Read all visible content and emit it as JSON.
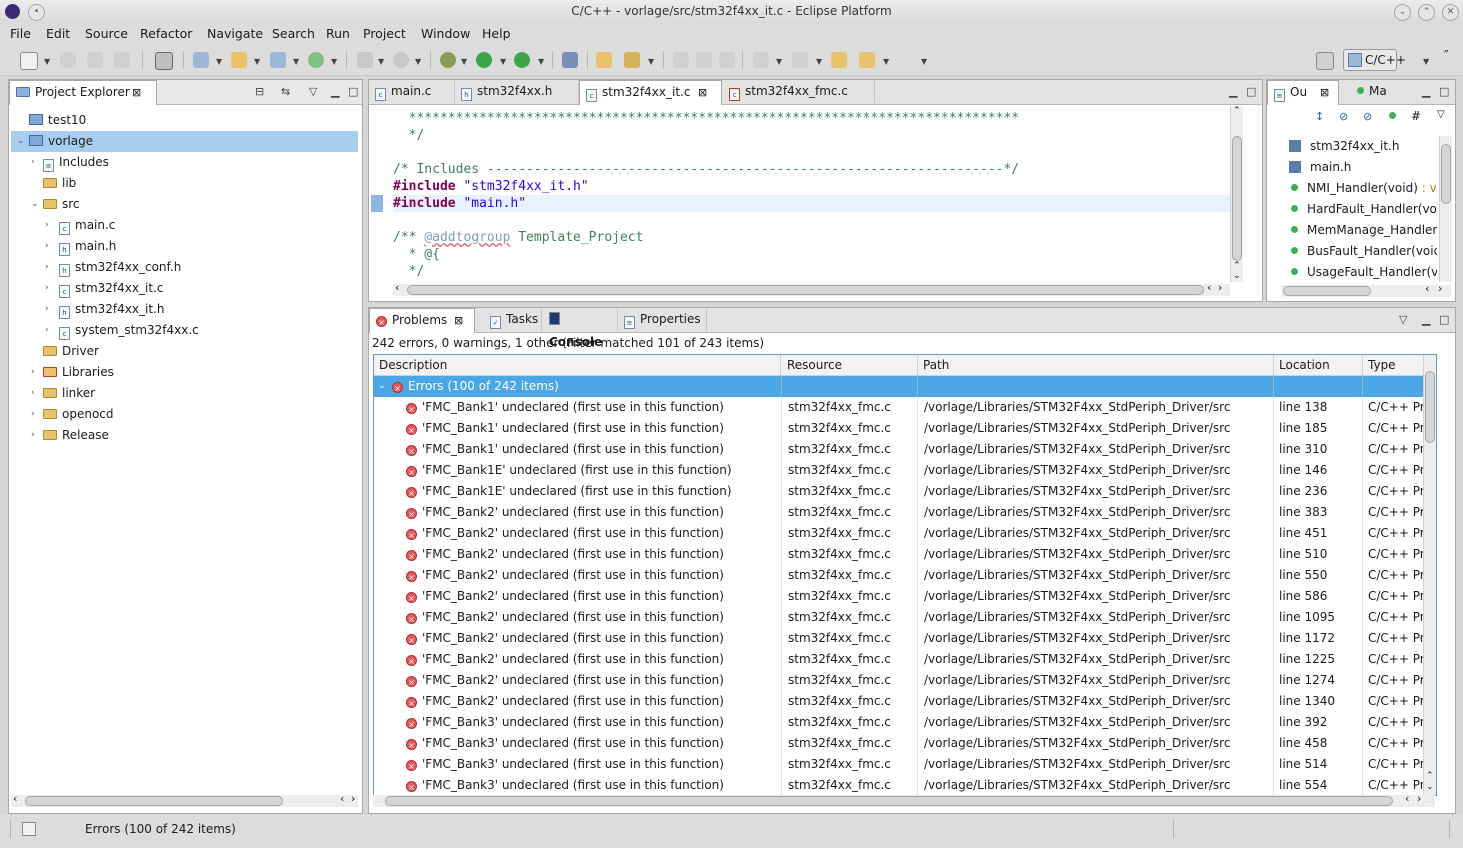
{
  "window": {
    "title": "C/C++ - vorlage/src/stm32f4xx_it.c - Eclipse Platform"
  },
  "menu": [
    "File",
    "Edit",
    "Source",
    "Refactor",
    "Navigate",
    "Search",
    "Run",
    "Project",
    "Window",
    "Help"
  ],
  "perspective": {
    "label": "C/C++"
  },
  "project_explorer": {
    "title": "Project Explorer",
    "items": [
      {
        "label": "test10"
      },
      {
        "label": "vorlage"
      },
      {
        "label": "Includes"
      },
      {
        "label": "lib"
      },
      {
        "label": "src"
      },
      {
        "label": "main.c"
      },
      {
        "label": "main.h"
      },
      {
        "label": "stm32f4xx_conf.h"
      },
      {
        "label": "stm32f4xx_it.c"
      },
      {
        "label": "stm32f4xx_it.h"
      },
      {
        "label": "system_stm32f4xx.c"
      },
      {
        "label": "Driver"
      },
      {
        "label": "Libraries"
      },
      {
        "label": "linker"
      },
      {
        "label": "openocd"
      },
      {
        "label": "Release"
      }
    ]
  },
  "editor": {
    "tabs": [
      {
        "label": "main.c"
      },
      {
        "label": "stm32f4xx.h"
      },
      {
        "label": "stm32f4xx_it.c"
      },
      {
        "label": "stm32f4xx_fmc.c"
      }
    ],
    "lines": {
      "l1": "  ******************************************************************************",
      "l2": "  */",
      "l4": "/* Includes ------------------------------------------------------------------*/",
      "l5a": "#include",
      "l5b": " \"stm32f4xx_it.h\"",
      "l6a": "#include",
      "l6b": " \"main.h\"",
      "l8a": "/** ",
      "l8b": "@addtogroup",
      "l8c": " Template_Project",
      "l9": "  * @{",
      "l10": "  */"
    }
  },
  "outline": {
    "tabs": [
      {
        "label": "Ou"
      },
      {
        "label": "Ma"
      }
    ],
    "items": [
      {
        "label": "stm32f4xx_it.h",
        "kind": "header"
      },
      {
        "label": "main.h",
        "kind": "header"
      },
      {
        "label": "NMI_Handler(void)",
        "suffix": " : void",
        "kind": "function"
      },
      {
        "label": "HardFault_Handler(void)",
        "kind": "function"
      },
      {
        "label": "MemManage_Handler",
        "kind": "function"
      },
      {
        "label": "BusFault_Handler(void)",
        "kind": "function"
      },
      {
        "label": "UsageFault_Handler(void)",
        "kind": "function"
      }
    ]
  },
  "bottom": {
    "tabs": [
      {
        "label": "Problems"
      },
      {
        "label": "Tasks"
      },
      {
        "label": "Console"
      },
      {
        "label": "Properties"
      }
    ],
    "summary": "242 errors, 0 warnings, 1 other (Filter matched 101 of 243 items)",
    "columns": [
      "Description",
      "Resource",
      "Path",
      "Location",
      "Type"
    ],
    "group": "Errors (100 of 242 items)",
    "rows": [
      {
        "d": "'FMC_Bank1' undeclared (first use in this function)",
        "r": "stm32f4xx_fmc.c",
        "p": "/vorlage/Libraries/STM32F4xx_StdPeriph_Driver/src",
        "l": "line 138",
        "t": "C/C++ Problem"
      },
      {
        "d": "'FMC_Bank1' undeclared (first use in this function)",
        "r": "stm32f4xx_fmc.c",
        "p": "/vorlage/Libraries/STM32F4xx_StdPeriph_Driver/src",
        "l": "line 185",
        "t": "C/C++ Problem"
      },
      {
        "d": "'FMC_Bank1' undeclared (first use in this function)",
        "r": "stm32f4xx_fmc.c",
        "p": "/vorlage/Libraries/STM32F4xx_StdPeriph_Driver/src",
        "l": "line 310",
        "t": "C/C++ Problem"
      },
      {
        "d": "'FMC_Bank1E' undeclared (first use in this function)",
        "r": "stm32f4xx_fmc.c",
        "p": "/vorlage/Libraries/STM32F4xx_StdPeriph_Driver/src",
        "l": "line 146",
        "t": "C/C++ Problem"
      },
      {
        "d": "'FMC_Bank1E' undeclared (first use in this function)",
        "r": "stm32f4xx_fmc.c",
        "p": "/vorlage/Libraries/STM32F4xx_StdPeriph_Driver/src",
        "l": "line 236",
        "t": "C/C++ Problem"
      },
      {
        "d": "'FMC_Bank2' undeclared (first use in this function)",
        "r": "stm32f4xx_fmc.c",
        "p": "/vorlage/Libraries/STM32F4xx_StdPeriph_Driver/src",
        "l": "line 383",
        "t": "C/C++ Problem"
      },
      {
        "d": "'FMC_Bank2' undeclared (first use in this function)",
        "r": "stm32f4xx_fmc.c",
        "p": "/vorlage/Libraries/STM32F4xx_StdPeriph_Driver/src",
        "l": "line 451",
        "t": "C/C++ Problem"
      },
      {
        "d": "'FMC_Bank2' undeclared (first use in this function)",
        "r": "stm32f4xx_fmc.c",
        "p": "/vorlage/Libraries/STM32F4xx_StdPeriph_Driver/src",
        "l": "line 510",
        "t": "C/C++ Problem"
      },
      {
        "d": "'FMC_Bank2' undeclared (first use in this function)",
        "r": "stm32f4xx_fmc.c",
        "p": "/vorlage/Libraries/STM32F4xx_StdPeriph_Driver/src",
        "l": "line 550",
        "t": "C/C++ Problem"
      },
      {
        "d": "'FMC_Bank2' undeclared (first use in this function)",
        "r": "stm32f4xx_fmc.c",
        "p": "/vorlage/Libraries/STM32F4xx_StdPeriph_Driver/src",
        "l": "line 586",
        "t": "C/C++ Problem"
      },
      {
        "d": "'FMC_Bank2' undeclared (first use in this function)",
        "r": "stm32f4xx_fmc.c",
        "p": "/vorlage/Libraries/STM32F4xx_StdPeriph_Driver/src",
        "l": "line 1095",
        "t": "C/C++ Problem"
      },
      {
        "d": "'FMC_Bank2' undeclared (first use in this function)",
        "r": "stm32f4xx_fmc.c",
        "p": "/vorlage/Libraries/STM32F4xx_StdPeriph_Driver/src",
        "l": "line 1172",
        "t": "C/C++ Problem"
      },
      {
        "d": "'FMC_Bank2' undeclared (first use in this function)",
        "r": "stm32f4xx_fmc.c",
        "p": "/vorlage/Libraries/STM32F4xx_StdPeriph_Driver/src",
        "l": "line 1225",
        "t": "C/C++ Problem"
      },
      {
        "d": "'FMC_Bank2' undeclared (first use in this function)",
        "r": "stm32f4xx_fmc.c",
        "p": "/vorlage/Libraries/STM32F4xx_StdPeriph_Driver/src",
        "l": "line 1274",
        "t": "C/C++ Problem"
      },
      {
        "d": "'FMC_Bank2' undeclared (first use in this function)",
        "r": "stm32f4xx_fmc.c",
        "p": "/vorlage/Libraries/STM32F4xx_StdPeriph_Driver/src",
        "l": "line 1340",
        "t": "C/C++ Problem"
      },
      {
        "d": "'FMC_Bank3' undeclared (first use in this function)",
        "r": "stm32f4xx_fmc.c",
        "p": "/vorlage/Libraries/STM32F4xx_StdPeriph_Driver/src",
        "l": "line 392",
        "t": "C/C++ Problem"
      },
      {
        "d": "'FMC_Bank3' undeclared (first use in this function)",
        "r": "stm32f4xx_fmc.c",
        "p": "/vorlage/Libraries/STM32F4xx_StdPeriph_Driver/src",
        "l": "line 458",
        "t": "C/C++ Problem"
      },
      {
        "d": "'FMC_Bank3' undeclared (first use in this function)",
        "r": "stm32f4xx_fmc.c",
        "p": "/vorlage/Libraries/STM32F4xx_StdPeriph_Driver/src",
        "l": "line 514",
        "t": "C/C++ Problem"
      },
      {
        "d": "'FMC_Bank3' undeclared (first use in this function)",
        "r": "stm32f4xx_fmc.c",
        "p": "/vorlage/Libraries/STM32F4xx_StdPeriph_Driver/src",
        "l": "line 554",
        "t": "C/C++ Problem"
      }
    ]
  },
  "status": {
    "text": "Errors (100 of 242 items)"
  },
  "colors": {
    "selection": "#a9cdf0",
    "group_row": "#4ba6e6",
    "error": "#e35a5a",
    "comment": "#3f7f5f",
    "keyword": "#7f0055",
    "string": "#2a00ff"
  }
}
